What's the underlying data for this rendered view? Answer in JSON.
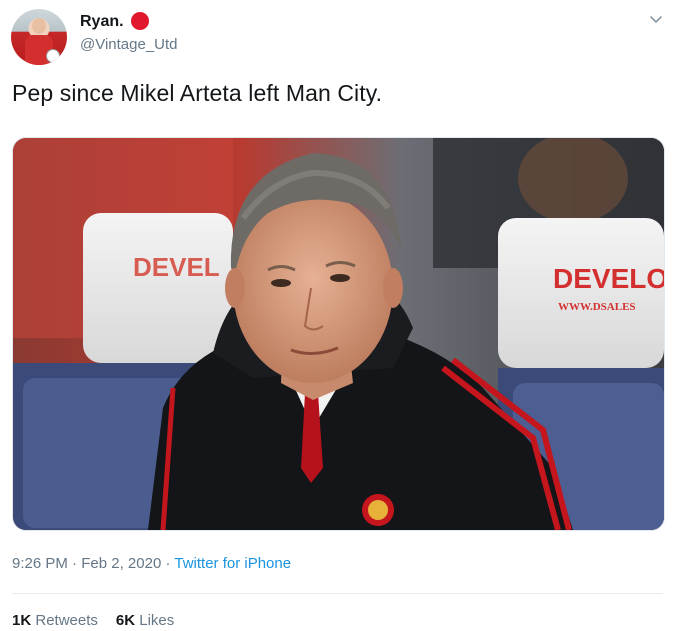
{
  "author": {
    "name": "Ryan.",
    "handle": "@Vintage_Utd",
    "badge_color": "#e0192e",
    "avatar_icon": "avatar"
  },
  "tweet": {
    "text": "Pep since Mikel Arteta left Man City.",
    "media": {
      "seat_text_left": "DEVEL",
      "seat_text_right": "DEVELO",
      "seat_sub_right": "WWW.DSALES"
    }
  },
  "meta": {
    "time": "9:26 PM",
    "separator": "·",
    "date": "Feb 2, 2020",
    "source": "Twitter for iPhone"
  },
  "stats": {
    "retweets_count": "1K",
    "retweets_label": "Retweets",
    "likes_count": "6K",
    "likes_label": "Likes"
  },
  "icons": {
    "menu": "chevron-down-icon"
  },
  "colors": {
    "link": "#1b95e0",
    "secondary_text": "#657786",
    "primary_text": "#14171a"
  }
}
